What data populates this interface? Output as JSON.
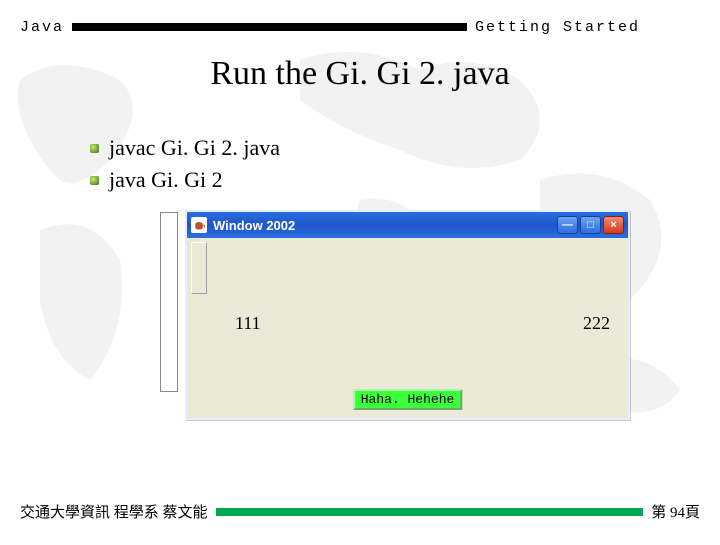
{
  "header": {
    "left": "Java",
    "right": "Getting Started"
  },
  "title": "Run the Gi. Gi 2. java",
  "bullets": [
    "javac  Gi. Gi 2. java",
    "java  Gi. Gi 2"
  ],
  "window": {
    "title": "Window 2002",
    "label_left": "111",
    "label_right": "222",
    "button": "Haha. Hehehe",
    "minimize_glyph": "—",
    "maximize_glyph": "□",
    "close_glyph": "×"
  },
  "footer": {
    "left": "交通大學資訊 程學系 蔡文能",
    "right": "第 94頁"
  }
}
